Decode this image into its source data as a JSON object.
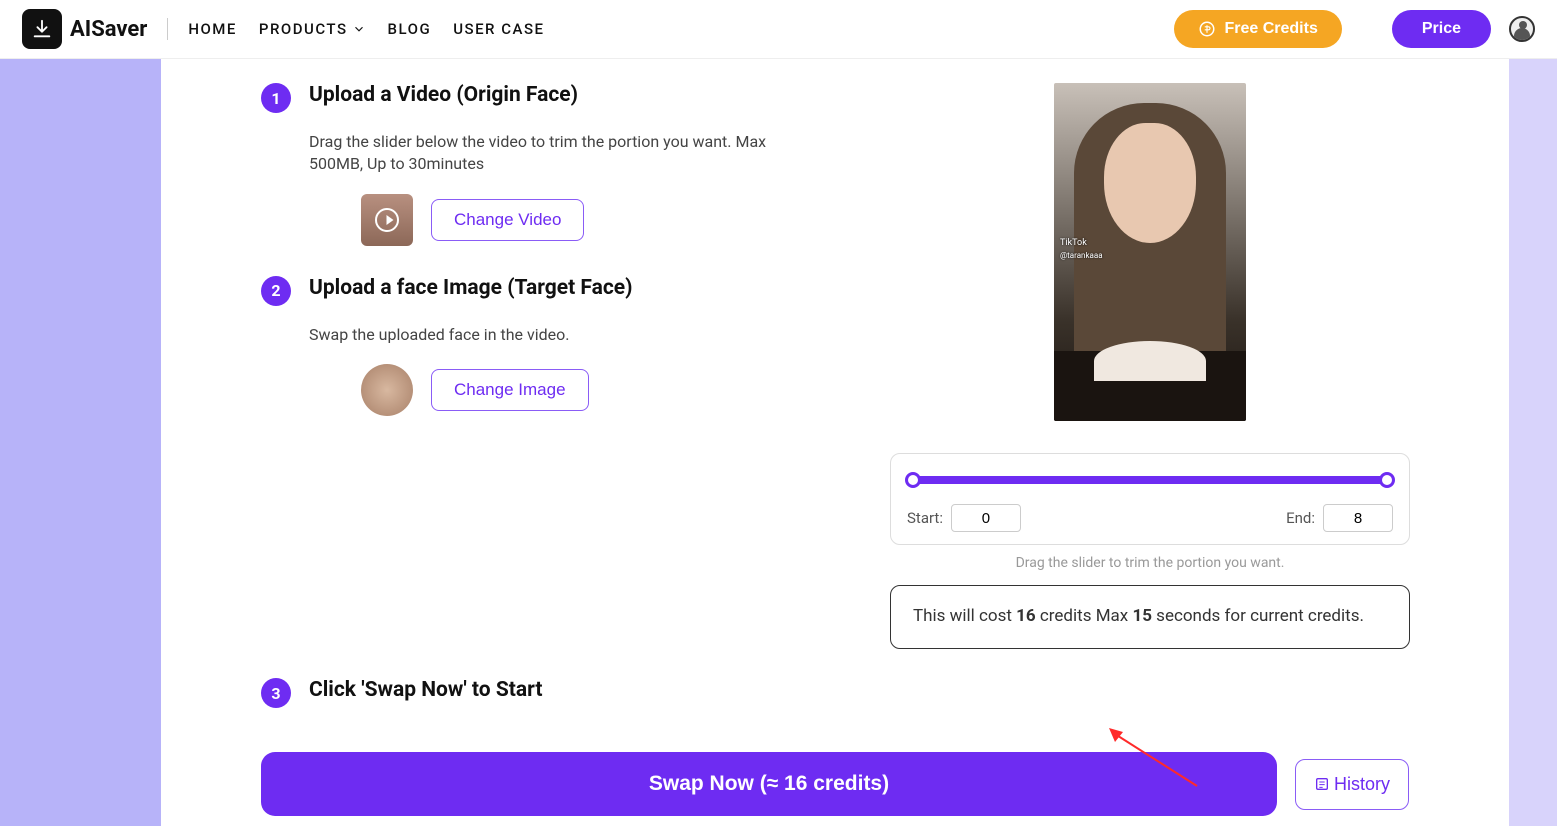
{
  "header": {
    "brand": "AISaver",
    "nav": {
      "home": "HOME",
      "products": "PRODUCTS",
      "blog": "BLOG",
      "usercase": "USER CASE"
    },
    "free_credits": "Free Credits",
    "price": "Price"
  },
  "steps": {
    "s1": {
      "num": "1",
      "title": "Upload a Video (Origin Face)",
      "desc": "Drag the slider below the video to trim the portion you want. Max 500MB, Up to 30minutes",
      "change": "Change Video"
    },
    "s2": {
      "num": "2",
      "title": "Upload a face Image (Target Face)",
      "desc": "Swap the uploaded face in the video.",
      "change": "Change Image"
    },
    "s3": {
      "num": "3",
      "title": "Click 'Swap Now' to Start"
    }
  },
  "preview": {
    "tiktok": "TikTok",
    "user": "@tarankaaa"
  },
  "slider": {
    "start_label": "Start:",
    "start_val": "0",
    "end_label": "End:",
    "end_val": "8",
    "hint": "Drag the slider to trim the portion you want."
  },
  "cost": {
    "pre": "This will cost ",
    "credits": "16",
    "mid": " credits Max ",
    "seconds": "15",
    "post": " seconds for current credits."
  },
  "actions": {
    "swap": "Swap Now (≈ 16 credits)",
    "history": "History"
  }
}
